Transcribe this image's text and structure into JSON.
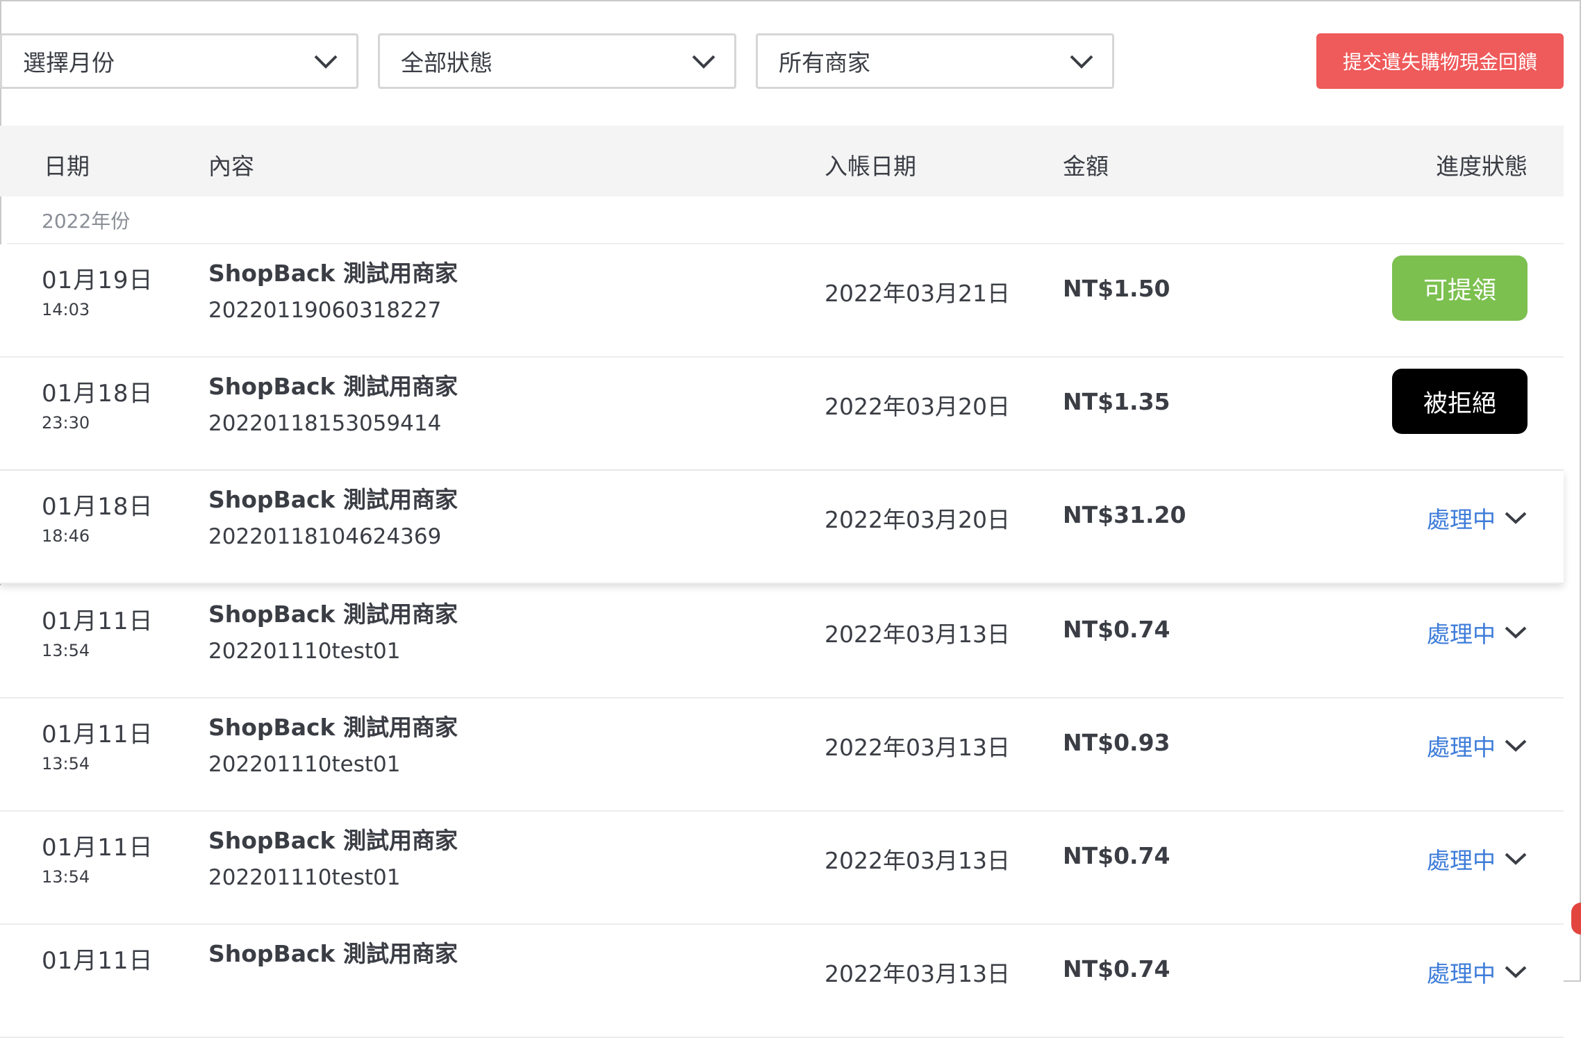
{
  "filters": {
    "month": "選擇月份",
    "status": "全部狀態",
    "merchant": "所有商家",
    "submit_label": "提交遺失購物現金回饋"
  },
  "table": {
    "headers": {
      "date": "日期",
      "content": "內容",
      "entry_date": "入帳日期",
      "amount": "金額",
      "status": "進度狀態"
    },
    "year_label": "2022年份",
    "rows": [
      {
        "date": "01月19日",
        "time": "14:03",
        "merchant": "ShopBack 測試用商家",
        "order": "2022011906031822​7",
        "entry": "2022年03月21日",
        "amount": "NT$1.50",
        "status": "可提領",
        "status_type": "claimable"
      },
      {
        "date": "01月18日",
        "time": "23:30",
        "merchant": "ShopBack 測試用商家",
        "order": "2022011815305941​4",
        "entry": "2022年03月20日",
        "amount": "NT$1.35",
        "status": "被拒絕",
        "status_type": "rejected"
      },
      {
        "date": "01月18日",
        "time": "18:46",
        "merchant": "ShopBack 測試用商家",
        "order": "2022011810462436​9",
        "entry": "2022年03月20日",
        "amount": "NT$31.20",
        "status": "處理中",
        "status_type": "processing"
      },
      {
        "date": "01月11日",
        "time": "13:54",
        "merchant": "ShopBack 測試用商家",
        "order": "202201110test01",
        "entry": "2022年03月13日",
        "amount": "NT$0.74",
        "status": "處理中",
        "status_type": "processing"
      },
      {
        "date": "01月11日",
        "time": "13:54",
        "merchant": "ShopBack 測試用商家",
        "order": "202201110test01",
        "entry": "2022年03月13日",
        "amount": "NT$0.93",
        "status": "處理中",
        "status_type": "processing"
      },
      {
        "date": "01月11日",
        "time": "13:54",
        "merchant": "ShopBack 測試用商家",
        "order": "202201110test01",
        "entry": "2022年03月13日",
        "amount": "NT$0.74",
        "status": "處理中",
        "status_type": "processing"
      },
      {
        "date": "01月11日",
        "time": "",
        "merchant": "ShopBack 測試用商家",
        "order": "",
        "entry": "2022年03月13日",
        "amount": "NT$0.74",
        "status": "處理中",
        "status_type": "processing"
      }
    ]
  },
  "colors": {
    "submit_button": "#ef5a5a",
    "claimable": "#7cc050",
    "rejected": "#000000",
    "processing_text": "#3d7cd9",
    "header_bg": "#f4f4f4"
  }
}
